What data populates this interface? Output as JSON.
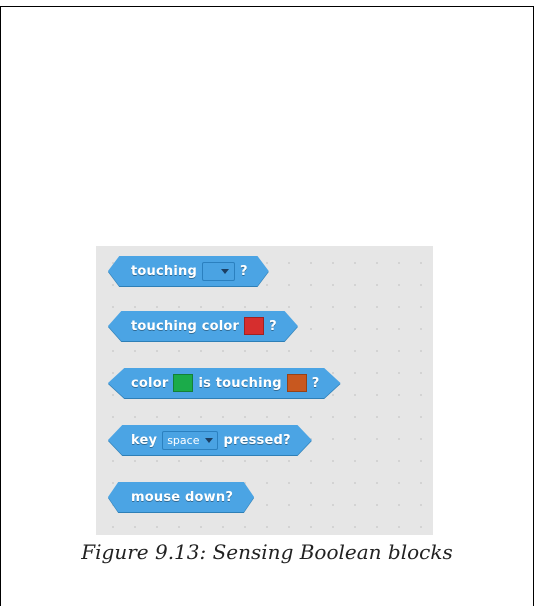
{
  "colors": {
    "block_fill": "#4ba4e4",
    "block_edge": "#2e7fb6",
    "palette_bg": "#e6e6e6",
    "swatch_red": "#d62e2e",
    "swatch_green": "#1bab4a",
    "swatch_orange": "#c8581f"
  },
  "blocks": {
    "touching": {
      "label": "touching",
      "question": "?",
      "dropdown_value": ""
    },
    "touching_color": {
      "label": "touching color",
      "swatch": "red",
      "question": "?"
    },
    "color_touching": {
      "label_start": "color",
      "swatch_1": "green",
      "label_mid": "is touching",
      "swatch_2": "orange",
      "question": "?"
    },
    "key_pressed": {
      "label_start": "key",
      "dropdown_value": "space",
      "label_end": "pressed?"
    },
    "mouse_down": {
      "label": "mouse down?"
    }
  },
  "caption": "Figure 9.13: Sensing Boolean blocks"
}
